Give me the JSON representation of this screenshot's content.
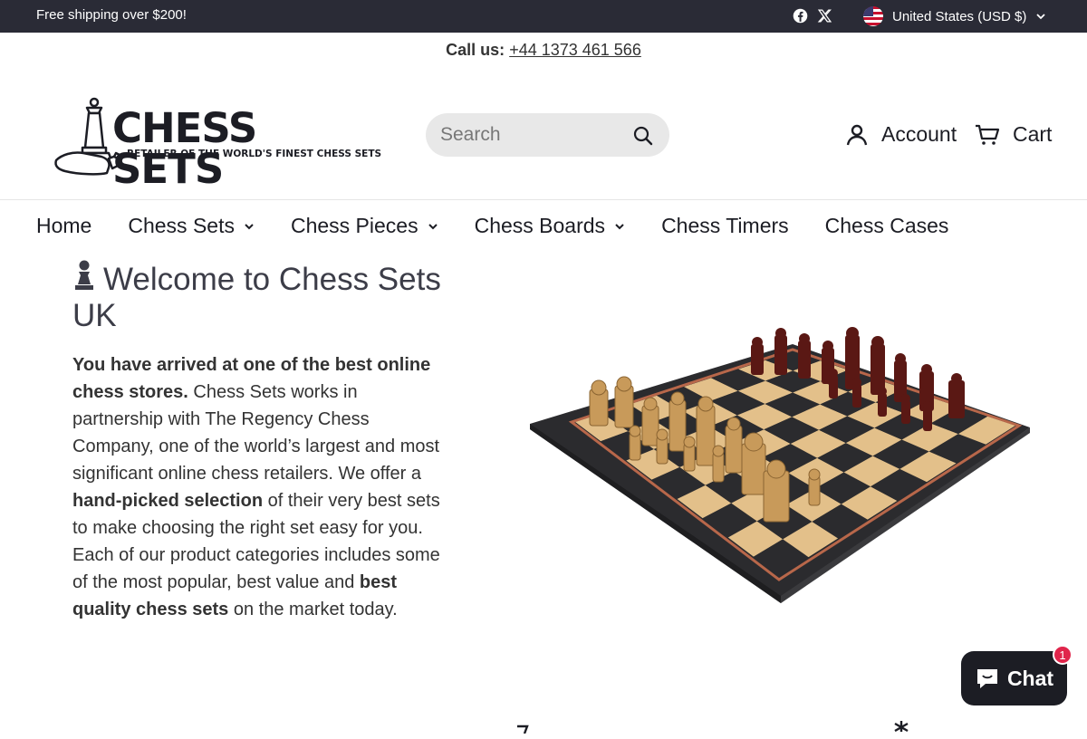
{
  "topbar": {
    "shipping_text": "Free shipping over $200!",
    "social": [
      "facebook-icon",
      "x-icon"
    ],
    "currency_label": "United States (USD $)",
    "background_color": "#2a2b36"
  },
  "callus": {
    "label": "Call us:",
    "phone": "+44 1373 461 566"
  },
  "logo": {
    "title": "CHESS SETS",
    "tagline": "RETAILER OF THE WORLD'S FINEST CHESS SETS"
  },
  "search": {
    "placeholder": "Search"
  },
  "header_actions": {
    "account_label": "Account",
    "cart_label": "Cart"
  },
  "nav": {
    "items": [
      {
        "label": "Home",
        "has_dropdown": false
      },
      {
        "label": "Chess Sets",
        "has_dropdown": true
      },
      {
        "label": "Chess Pieces",
        "has_dropdown": true
      },
      {
        "label": "Chess Boards",
        "has_dropdown": true
      },
      {
        "label": "Chess Timers",
        "has_dropdown": false
      },
      {
        "label": "Chess Cases",
        "has_dropdown": false
      }
    ]
  },
  "main": {
    "heading": "Welcome to Chess Sets UK",
    "paragraph": {
      "p1_bold": "You have arrived at one of the best online chess stores.",
      "p2": " Chess Sets works in partnership with The Regency Chess Company, one of the world’s largest and most significant online chess retailers. We offer a ",
      "p3_bold": "hand-picked selection",
      "p4": " of their very best sets to make choosing the right set easy for you. Each of our product categories includes some of the most popular, best value and ",
      "p5_bold": "best quality chess sets",
      "p6": " on the market today."
    }
  },
  "chat": {
    "label": "Chat",
    "badge_count": "1"
  },
  "colors": {
    "accent_dark": "#1c1d24",
    "badge_red": "#e0254b",
    "search_bg": "#e8e8e8"
  }
}
